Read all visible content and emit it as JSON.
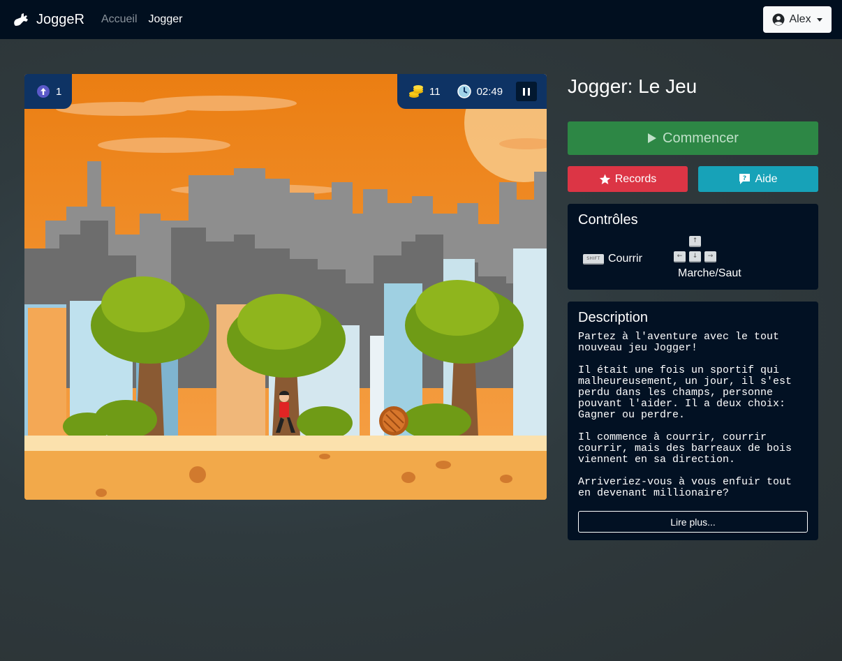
{
  "navbar": {
    "brand": "JoggeR",
    "links": [
      {
        "label": "Accueil"
      },
      {
        "label": "Jogger"
      }
    ],
    "user": {
      "name": "Alex"
    }
  },
  "game": {
    "hud": {
      "level": "1",
      "coins": "11",
      "timer": "02:49"
    }
  },
  "sidebar": {
    "title": "Jogger: Le Jeu",
    "start_label": "Commencer",
    "records_label": "Records",
    "help_label": "Aide",
    "controls": {
      "title": "Contrôles",
      "shift_key": "SHIFT",
      "shift_action": "Courrir",
      "arrows_action": "Marche/Saut"
    },
    "description": {
      "title": "Description",
      "text": "Partez à l'aventure avec le tout\nnouveau jeu Jogger!\n\nIl était une fois un sportif qui\nmalheureusement, un jour, il s'est\nperdu dans les champs, personne\npouvant l'aider. Il a deux choix:\nGagner ou perdre.\n\nIl commence à courrir, courrir\ncourrir, mais des barreaux de bois\nviennent en sa direction.\n\nArriveriez-vous à vous enfuir tout\nen devenant millionaire?",
      "read_more": "Lire plus..."
    }
  },
  "colors": {
    "navbar": "#010f1f",
    "start": "#2d8745",
    "records": "#dc3545",
    "help": "#17a2b8",
    "hud": "#0e3364",
    "card": "#021123"
  }
}
